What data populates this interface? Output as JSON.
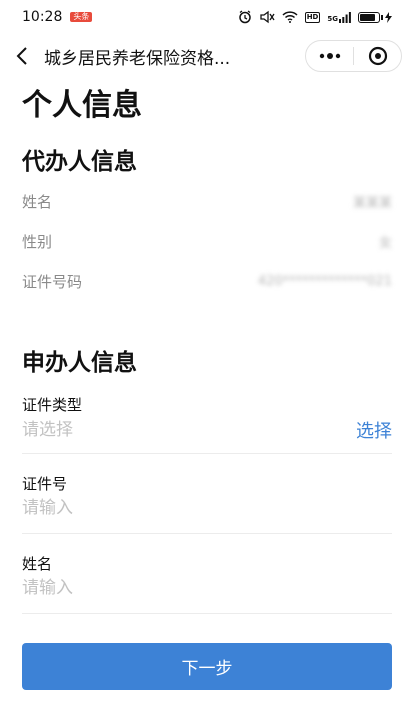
{
  "status_bar": {
    "time": "10:28",
    "notification_badge": "头条",
    "network_label": "5G"
  },
  "nav": {
    "title": "城乡居民养老保险资格...",
    "more_icon": "more-dots-icon",
    "close_icon": "target-circle-icon"
  },
  "page": {
    "title": "个人信息"
  },
  "agent_section": {
    "title": "代办人信息",
    "rows": [
      {
        "label": "姓名",
        "value": "某某某"
      },
      {
        "label": "性别",
        "value": "女"
      },
      {
        "label": "证件号码",
        "value": "420*************021"
      }
    ]
  },
  "applicant_section": {
    "title": "申办人信息",
    "id_type": {
      "label": "证件类型",
      "placeholder": "请选择",
      "action": "选择"
    },
    "id_number": {
      "label": "证件号",
      "placeholder": "请输入"
    },
    "name": {
      "label": "姓名",
      "placeholder": "请输入"
    }
  },
  "footer": {
    "next_label": "下一步"
  },
  "colors": {
    "accent": "#3d82d6",
    "badge": "#e84b3c",
    "muted_label": "#8a8a8a",
    "placeholder": "#c2c2c2"
  }
}
